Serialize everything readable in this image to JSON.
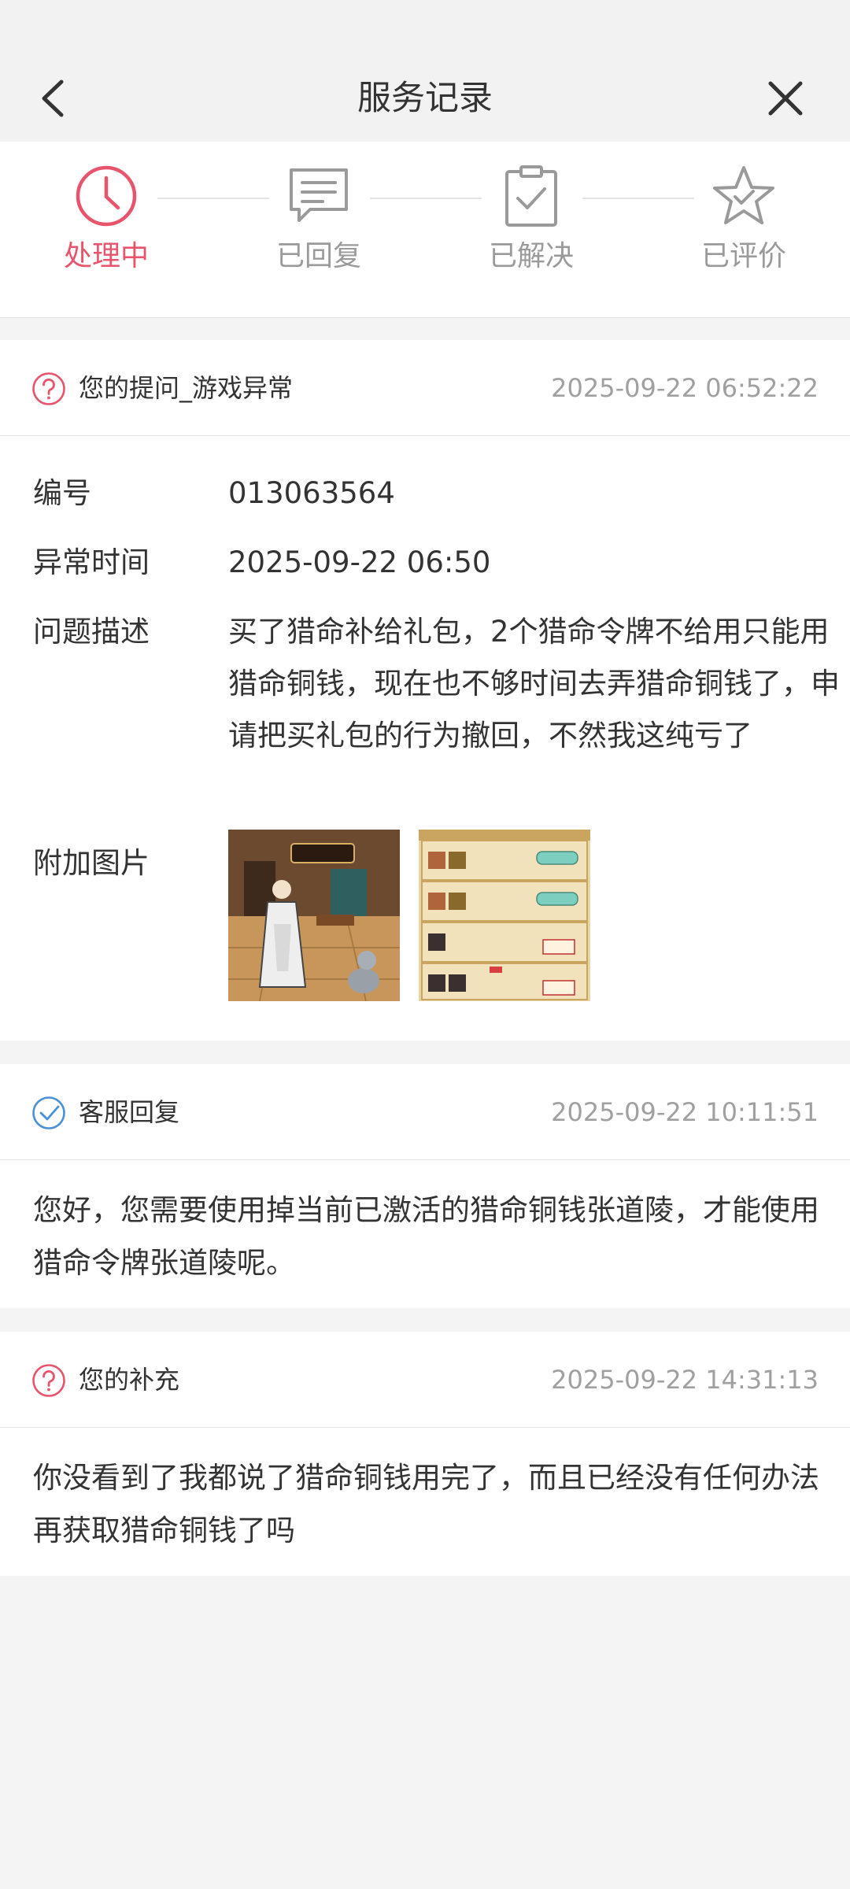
{
  "header": {
    "title": "服务记录",
    "back_icon": "chevron-left-icon",
    "close_icon": "close-icon"
  },
  "steps": [
    {
      "label": "处理中",
      "icon": "clock-icon",
      "active": true
    },
    {
      "label": "已回复",
      "icon": "message-icon",
      "active": false
    },
    {
      "label": "已解决",
      "icon": "clipboard-check-icon",
      "active": false
    },
    {
      "label": "已评价",
      "icon": "star-check-icon",
      "active": false
    }
  ],
  "colors": {
    "accent": "#e8546c",
    "inactive": "#9a9a9a",
    "reply_icon": "#4a90d9"
  },
  "question": {
    "title": "您的提问_游戏异常",
    "time": "2025-09-22 06:52:22",
    "id_label": "编号",
    "id_value": "013063564",
    "abnormal_time_label": "异常时间",
    "abnormal_time_value": "2025-09-22 06:50",
    "desc_label": "问题描述",
    "desc_value": "买了猎命补给礼包，2个猎命令牌不给用只能用猎命铜钱，现在也不够时间去弄猎命铜钱了，申请把买礼包的行为撤回，不然我这纯亏了",
    "images_label": "附加图片",
    "images": [
      {
        "name": "game-screenshot-1"
      },
      {
        "name": "game-screenshot-2"
      }
    ]
  },
  "reply": {
    "title": "客服回复",
    "time": "2025-09-22 10:11:51",
    "text": "您好，您需要使用掉当前已激活的猎命铜钱张道陵，才能使用猎命令牌张道陵呢。"
  },
  "supplement": {
    "title": "您的补充",
    "time": "2025-09-22 14:31:13",
    "text": "你没看到了我都说了猎命铜钱用完了，而且已经没有任何办法再获取猎命铜钱了吗"
  }
}
